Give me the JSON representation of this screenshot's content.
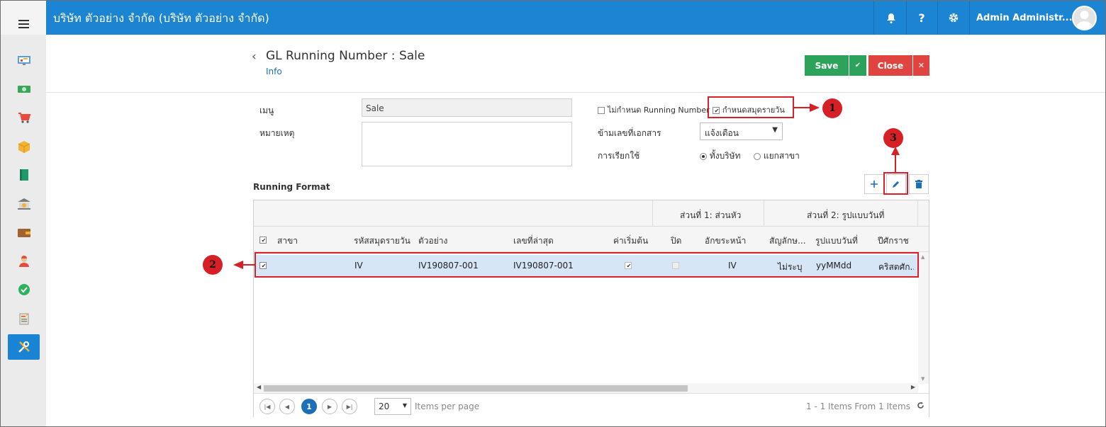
{
  "app": {
    "company": "บริษัท ตัวอย่าง จำกัด (บริษัท ตัวอย่าง จำกัด)",
    "user": "Admin Administr...",
    "help_symbol": "?"
  },
  "page": {
    "title": "GL Running Number : Sale",
    "subtitle": "Info",
    "save_label": "Save",
    "close_label": "Close"
  },
  "form": {
    "menu_label": "เมนู",
    "menu_value": "Sale",
    "note_label": "หมายเหตุ",
    "no_running_label": "ไม่กำหนด Running Number",
    "daily_label": "กำหนดสมุดรายวัน",
    "skip_label": "ข้ามเลขที่เอกสาร",
    "skip_value": "แจ้งเตือน",
    "usage_label": "การเรียกใช้",
    "usage_company": "ทั้งบริษัท",
    "usage_branch": "แยกสาขา"
  },
  "running_format": {
    "title": "Running Format",
    "group1": "ส่วนที่ 1: ส่วนหัว",
    "group2": "ส่วนที่ 2: รูปแบบวันที่",
    "columns": [
      "สาขา",
      "รหัสสมุดรายวัน",
      "ตัวอย่าง",
      "เลขที่ล่าสุด",
      "ค่าเริ่มต้น",
      "ปิด",
      "อักขระหน้า",
      "สัญลักษ...",
      "รูปแบบวันที่",
      "ปีศักราช"
    ],
    "rows": [
      {
        "branch": "",
        "journal_code": "IV",
        "example": "IV190807-001",
        "last_number": "IV190807-001",
        "default": true,
        "closed": false,
        "prefix": "IV",
        "symbol": "ไม่ระบุ",
        "date_format": "yyMMdd",
        "era": "คริสตศัก..."
      }
    ]
  },
  "pager": {
    "current_page": "1",
    "page_size": "20",
    "per_page_label": "Items per page",
    "summary": "1 - 1 Items From 1 Items"
  },
  "callouts": {
    "c1": "1",
    "c2": "2",
    "c3": "3"
  },
  "colors": {
    "topbar": "#1b84d3",
    "save": "#2ca25b",
    "close": "#e0443e",
    "highlight": "#d9202a",
    "selected_row": "#d6e6f7"
  }
}
